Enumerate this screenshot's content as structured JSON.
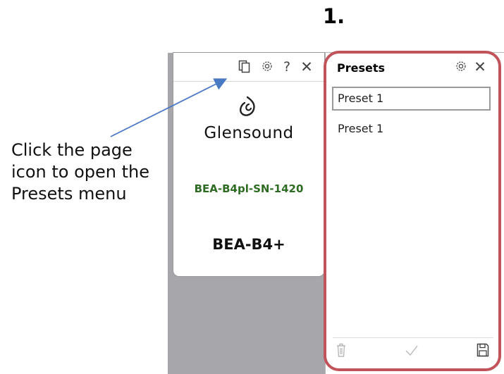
{
  "step": {
    "number": "1."
  },
  "device": {
    "toolbar": {
      "presets_icon": "page-icon",
      "settings_icon": "gear-icon",
      "help_label": "?",
      "close_label": "✕"
    },
    "logo_icon": "glensound-logo-icon",
    "brand": "Glensound",
    "serial": "BEA-B4pl-SN-1420",
    "model": "BEA-B4+"
  },
  "presets": {
    "title": "Presets",
    "settings_icon": "gear-icon",
    "close_label": "✕",
    "selected_value": "Preset 1",
    "items": [
      {
        "label": "Preset 1"
      }
    ],
    "footer": {
      "delete_icon": "trash-icon",
      "confirm_icon": "check-icon",
      "save_icon": "save-icon"
    }
  },
  "annotation": {
    "text": "Click the page icon to open the Presets menu",
    "arrow_color": "#4a79c4",
    "highlight_color": "#c0545a"
  },
  "colors": {
    "serial_green": "#2e6b22",
    "background_gray": "#a7a7ab"
  }
}
